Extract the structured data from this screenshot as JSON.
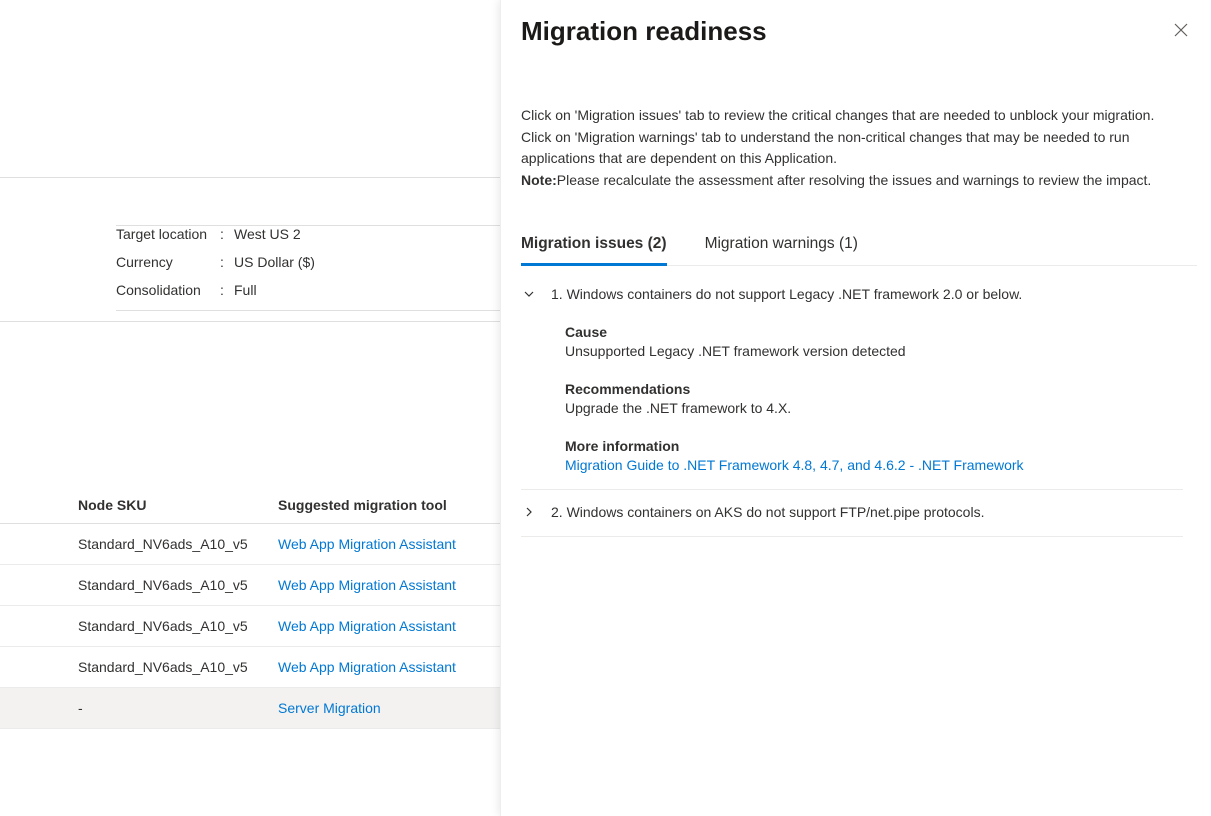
{
  "meta": {
    "target_location_label": "Target location",
    "target_location_value": "West US 2",
    "currency_label": "Currency",
    "currency_value": "US Dollar ($)",
    "consolidation_label": "Consolidation",
    "consolidation_value": "Full"
  },
  "table": {
    "headers": {
      "sku": "Node SKU",
      "tool": "Suggested migration tool"
    },
    "rows": [
      {
        "sku": "Standard_NV6ads_A10_v5",
        "tool": "Web App Migration Assistant"
      },
      {
        "sku": "Standard_NV6ads_A10_v5",
        "tool": "Web App Migration Assistant"
      },
      {
        "sku": "Standard_NV6ads_A10_v5",
        "tool": "Web App Migration Assistant"
      },
      {
        "sku": "Standard_NV6ads_A10_v5",
        "tool": "Web App Migration Assistant"
      },
      {
        "sku": "-",
        "tool": "Server Migration",
        "selected": true
      }
    ]
  },
  "flyout": {
    "title": "Migration readiness",
    "desc_line1": "Click on 'Migration issues' tab to review the critical changes that are needed to unblock your migration. Click on 'Migration warnings' tab to understand the non-critical changes that may be needed to run applications that are dependent on this Application.",
    "note_label": "Note:",
    "note_text": "Please recalculate the assessment after resolving the issues and warnings to review the impact.",
    "tabs": {
      "issues": "Migration issues (2)",
      "warnings": "Migration warnings (1)"
    },
    "issues": [
      {
        "num": "1.",
        "title": "Windows containers do not support Legacy .NET framework 2.0 or below.",
        "expanded": true,
        "cause_label": "Cause",
        "cause_text": "Unsupported Legacy .NET framework version detected",
        "rec_label": "Recommendations",
        "rec_text": "Upgrade the .NET framework to 4.X.",
        "more_label": "More information",
        "more_link": "Migration Guide to .NET Framework 4.8, 4.7, and 4.6.2 - .NET Framework"
      },
      {
        "num": "2.",
        "title": "Windows containers on AKS do not support FTP/net.pipe protocols.",
        "expanded": false
      }
    ]
  }
}
